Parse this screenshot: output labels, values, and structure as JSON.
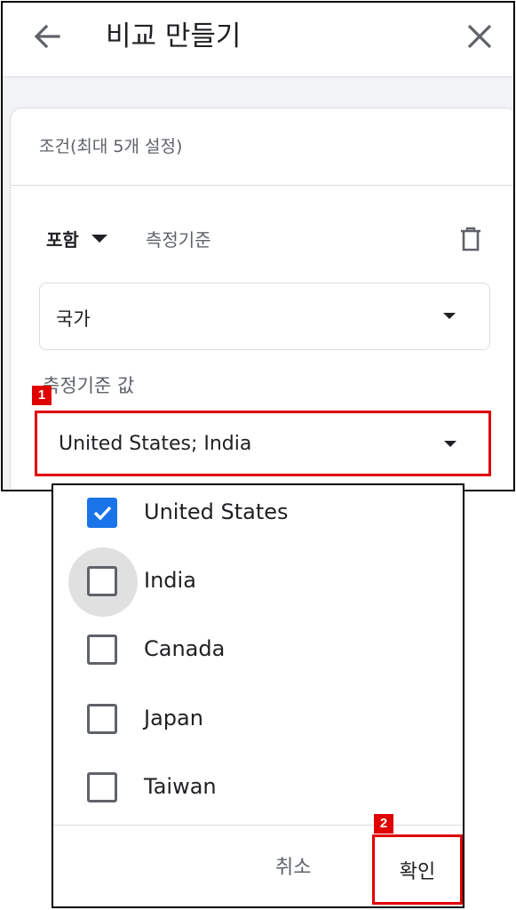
{
  "header": {
    "title": "비교 만들기"
  },
  "conditions": {
    "label": "조건(최대 5개 설정)",
    "include_label": "포함",
    "dimension_label": "측정기준",
    "dimension_value": "국가",
    "dimension_values_label": "측정기준 값",
    "selected_values": "United States; India"
  },
  "options": [
    {
      "label": "United States",
      "checked": true
    },
    {
      "label": "India",
      "checked": false
    },
    {
      "label": "Canada",
      "checked": false
    },
    {
      "label": "Japan",
      "checked": false
    },
    {
      "label": "Taiwan",
      "checked": false
    }
  ],
  "dialog_buttons": {
    "cancel": "취소",
    "confirm": "확인"
  },
  "annotations": {
    "badge_1": "1",
    "badge_2": "2"
  },
  "colors": {
    "accent": "#1a73e8",
    "highlight": "#e00000"
  }
}
